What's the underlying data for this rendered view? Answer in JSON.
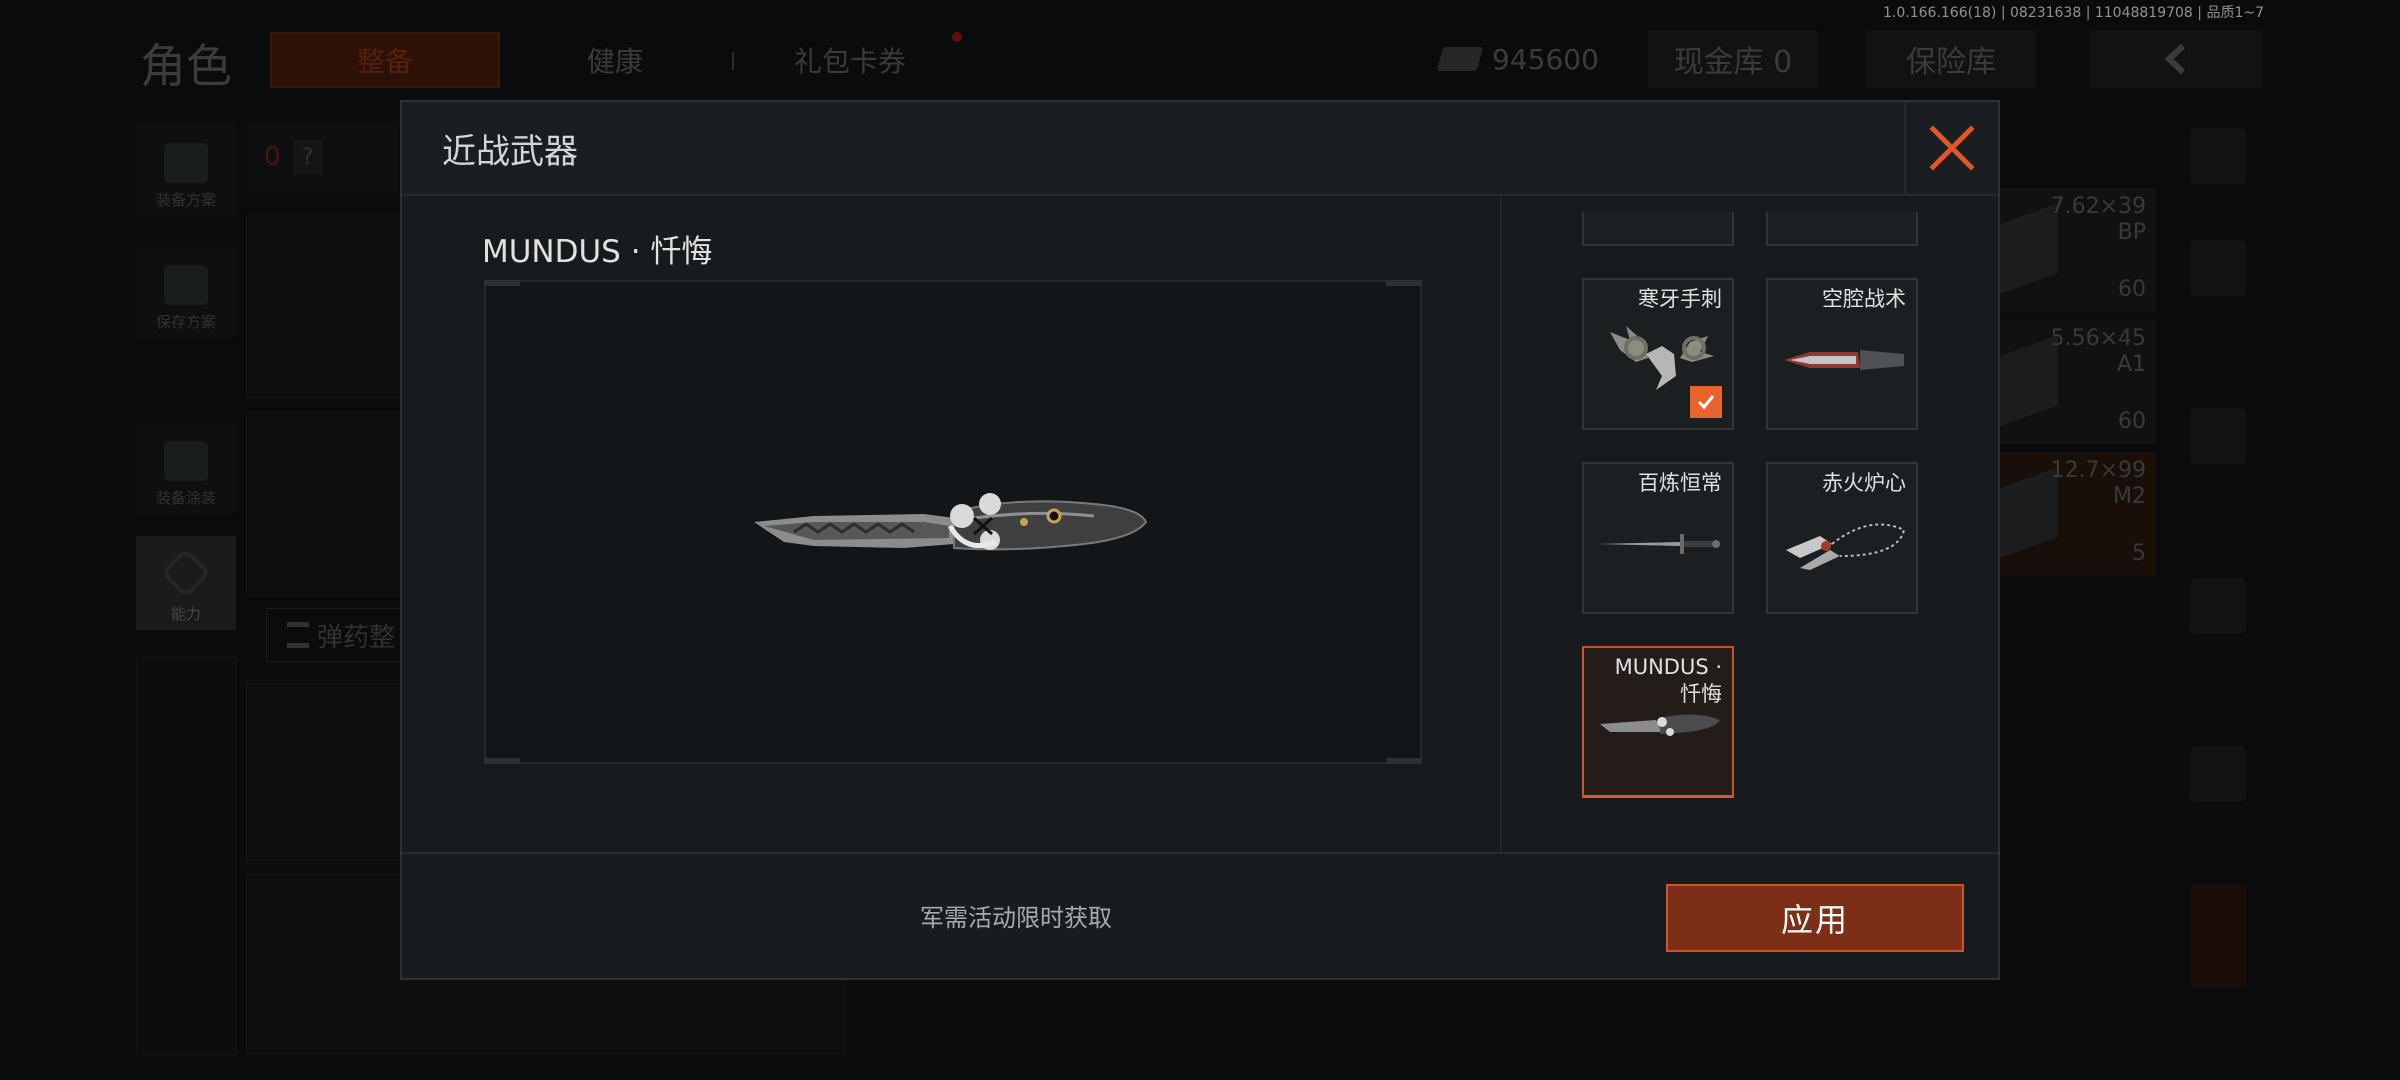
{
  "status_bar": {
    "version": "1.0.166.166(18) | 08231638 | 11048819708 | 品质1~7"
  },
  "background": {
    "page_title": "角色",
    "tabs": [
      {
        "label": "整备",
        "active": true
      },
      {
        "label": "健康",
        "active": false
      },
      {
        "label": "礼包卡券",
        "active": false,
        "has_notification": true
      }
    ],
    "money": {
      "icon": "cash-icon",
      "value": "945600"
    },
    "cash_vault_label": "现金库 0",
    "safe_label": "保险库",
    "back_icon": "chevron-left-icon",
    "side_menu": [
      {
        "label": "装备方案",
        "icon": "vest-icon"
      },
      {
        "label": "保存方案",
        "icon": "download-icon"
      },
      {
        "label": "装备涂装",
        "icon": "soldier-icon"
      },
      {
        "label": "能力",
        "icon": "ability-icon",
        "active": true
      }
    ],
    "left_pill": {
      "count": "0",
      "help": "?"
    },
    "ammo_button_label": "弹药整",
    "ammo_rows": [
      {
        "caliber": "7.62×39",
        "type": "BP",
        "qty": "60"
      },
      {
        "caliber": "5.56×45",
        "type": "A1",
        "qty": "60"
      },
      {
        "caliber": "12.7×99",
        "type": "M2",
        "qty": "5"
      }
    ]
  },
  "modal": {
    "title": "近战武器",
    "close_icon": "close-icon",
    "preview": {
      "weapon_name": "MUNDUS · 忏悔"
    },
    "weapons": [
      {
        "name": "寒牙手刺",
        "equipped": true,
        "selected": false
      },
      {
        "name": "空腔战术",
        "equipped": false,
        "selected": false
      },
      {
        "name": "百炼恒常",
        "equipped": false,
        "selected": false
      },
      {
        "name": "赤火炉心",
        "equipped": false,
        "selected": false
      },
      {
        "name": "MUNDUS · 忏悔",
        "equipped": false,
        "selected": true
      }
    ],
    "obtain_text": "军需活动限时获取",
    "apply_label": "应用",
    "colors": {
      "accent": "#e9642d",
      "apply_bg": "#7c2e16",
      "close": "#e0552a"
    }
  }
}
